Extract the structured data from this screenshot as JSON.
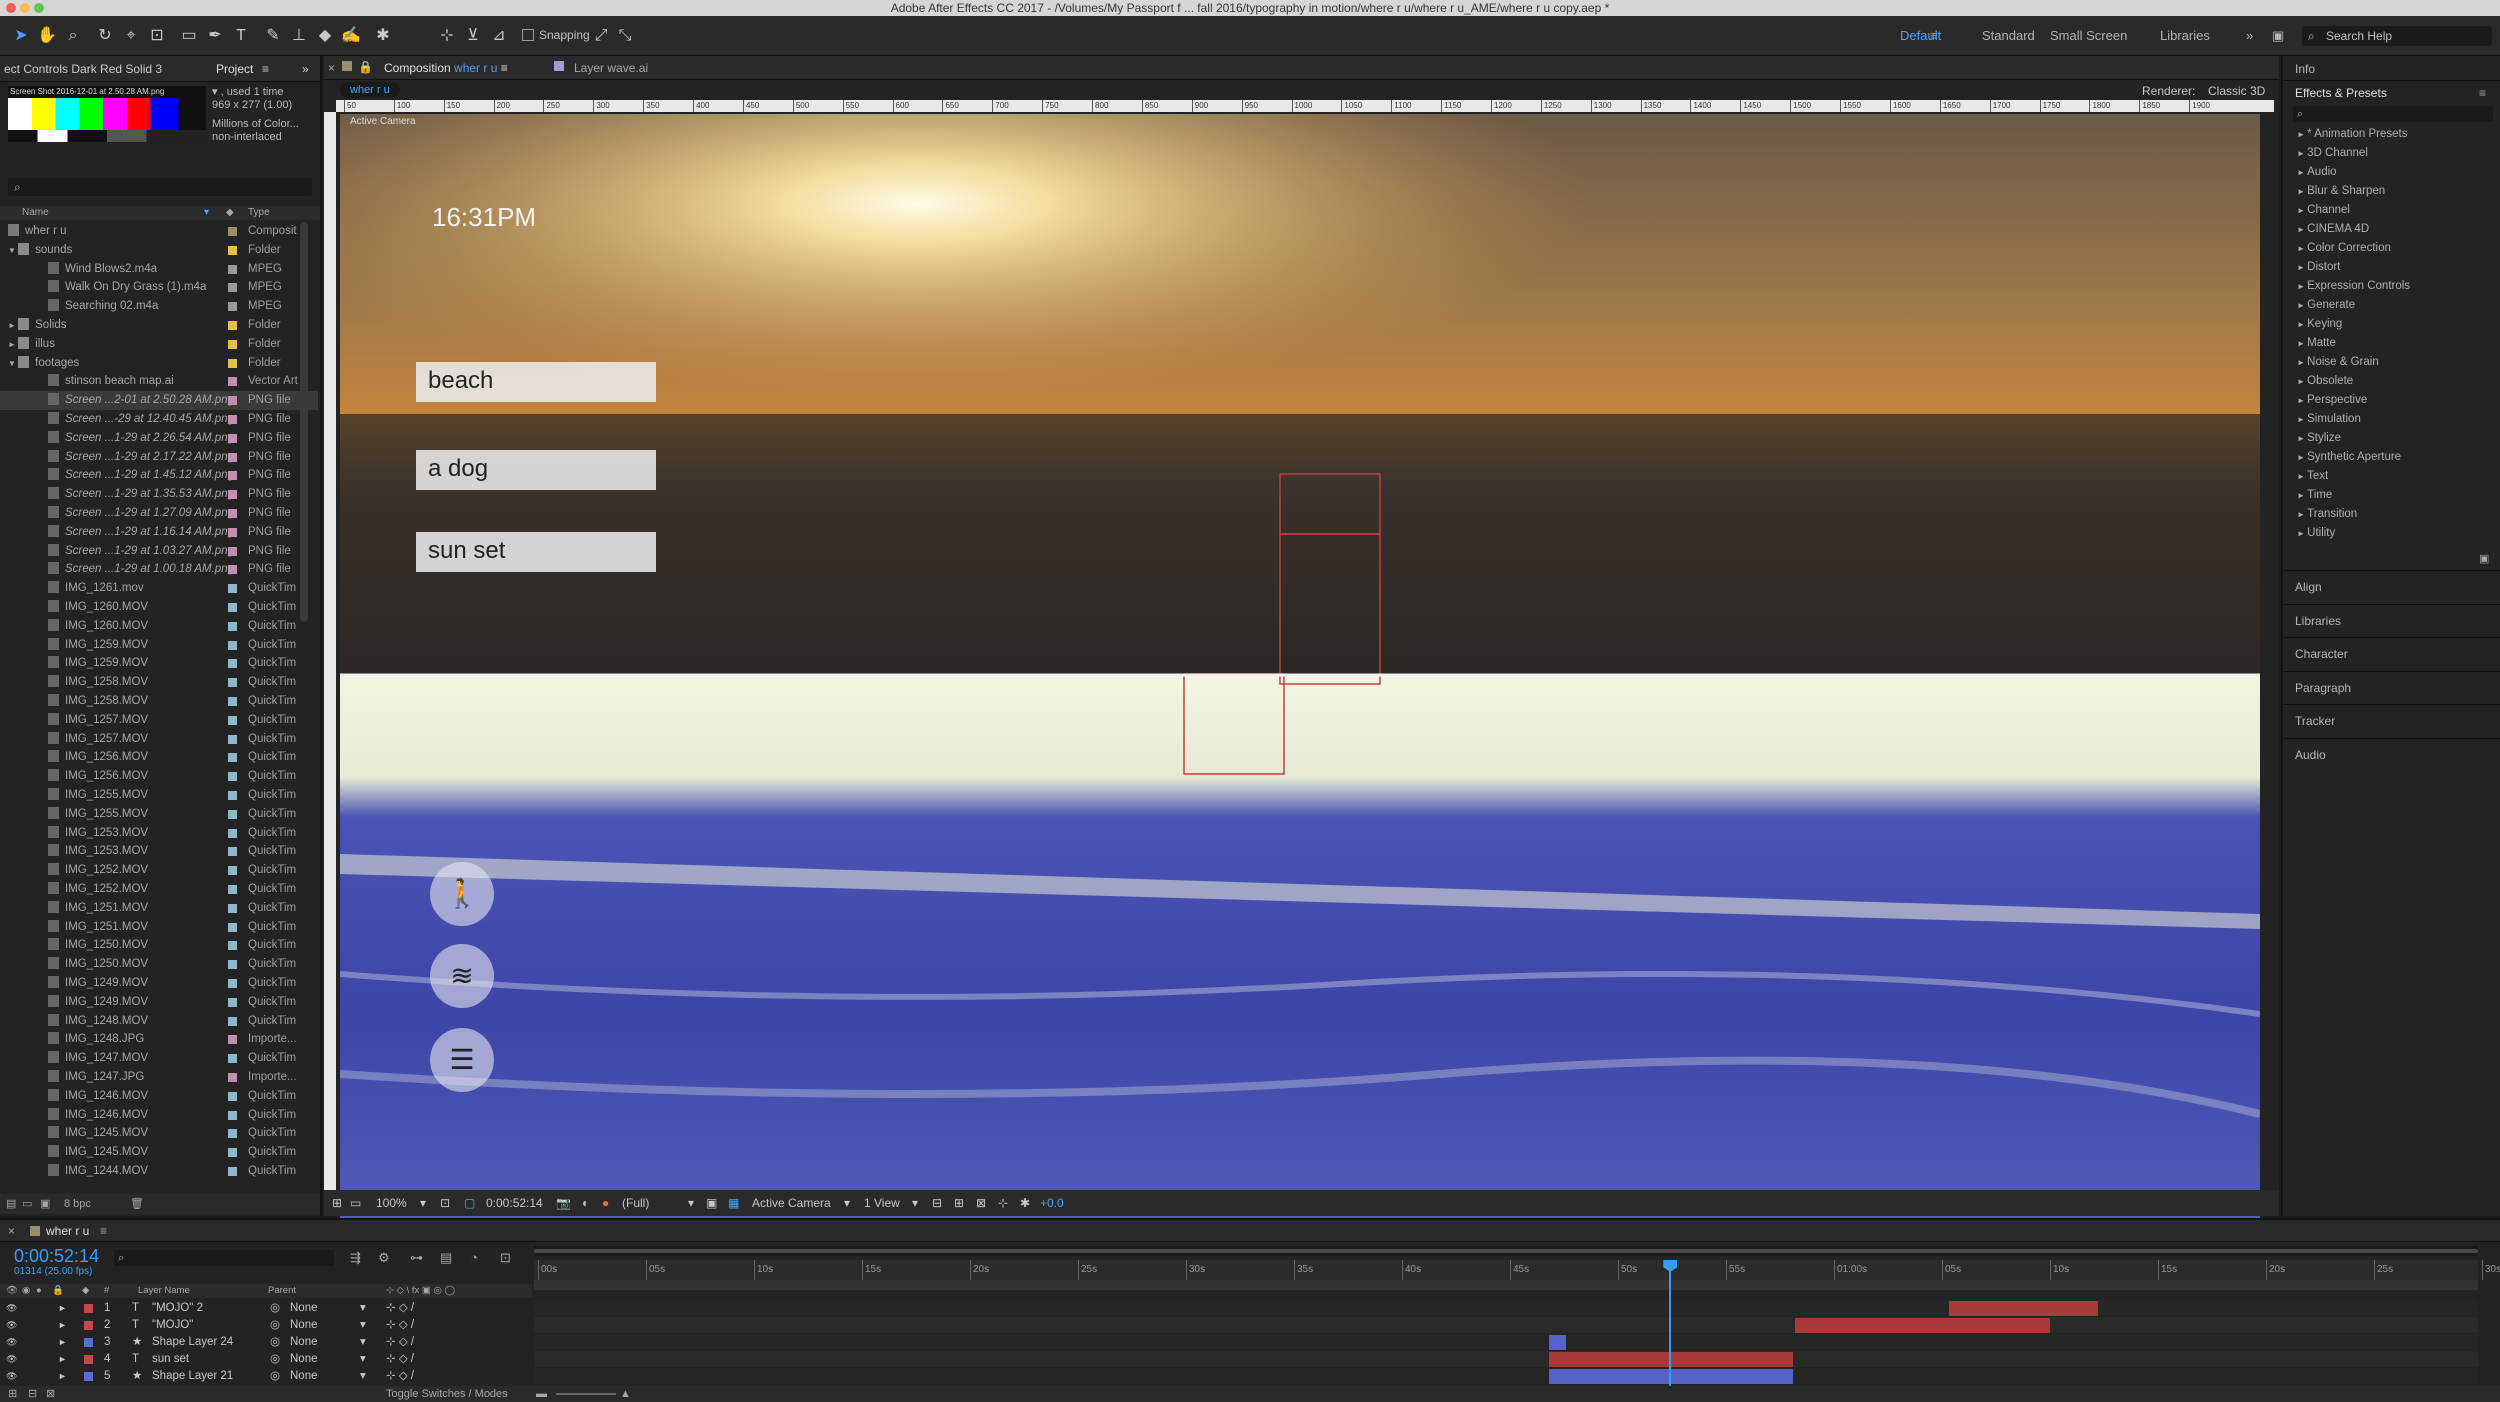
{
  "titlebar": {
    "title": "Adobe After Effects CC 2017 - /Volumes/My Passport f ... fall 2016/typography in motion/where r u/where r u_AME/where r u copy.aep *"
  },
  "toolbar": {
    "snapping": "Snapping",
    "workspaces": [
      "Default",
      "Standard",
      "Small Screen",
      "Libraries"
    ],
    "search": "Search Help"
  },
  "effect_controls": {
    "tab": "ect Controls Dark Red Solid 3",
    "project_tab": "Project"
  },
  "project": {
    "thumb_caption": "Screen Shot 2016-12-01 at 2.50.28 AM.png",
    "info": [
      "▾ , used 1 time",
      "969 x 277 (1.00)",
      "Millions of Color...",
      "non-interlaced"
    ],
    "col_name": "Name",
    "col_type": "Type",
    "items": [
      {
        "name": "wher r u",
        "type": "Composit",
        "indent": 0,
        "swatch": "#9a8f6a",
        "kind": "comp"
      },
      {
        "name": "sounds",
        "type": "Folder",
        "indent": 0,
        "swatch": "#e6c14a",
        "kind": "folder",
        "open": true
      },
      {
        "name": "Wind Blows2.m4a",
        "type": "MPEG",
        "indent": 2,
        "swatch": "#9a9a9a",
        "kind": "file"
      },
      {
        "name": "Walk On Dry Grass (1).m4a",
        "type": "MPEG",
        "indent": 2,
        "swatch": "#9a9a9a",
        "kind": "file"
      },
      {
        "name": "Searching 02.m4a",
        "type": "MPEG",
        "indent": 2,
        "swatch": "#9a9a9a",
        "kind": "file"
      },
      {
        "name": "Solids",
        "type": "Folder",
        "indent": 0,
        "swatch": "#e6c14a",
        "kind": "folder"
      },
      {
        "name": "illus",
        "type": "Folder",
        "indent": 0,
        "swatch": "#e6c14a",
        "kind": "folder"
      },
      {
        "name": "footages",
        "type": "Folder",
        "indent": 0,
        "swatch": "#e6c14a",
        "kind": "folder",
        "open": true
      },
      {
        "name": "stinson beach map.ai",
        "type": "Vector Art",
        "indent": 2,
        "swatch": "#c28fb0",
        "kind": "file"
      },
      {
        "name": "Screen ...2-01 at 2.50.28 AM.png",
        "type": "PNG file",
        "indent": 2,
        "swatch": "#c28fb0",
        "kind": "file",
        "selected": true
      },
      {
        "name": "Screen ...-29 at 12.40.45 AM.png",
        "type": "PNG file",
        "indent": 2,
        "swatch": "#c28fb0",
        "kind": "file"
      },
      {
        "name": "Screen ...1-29 at 2.26.54 AM.png",
        "type": "PNG file",
        "indent": 2,
        "swatch": "#c28fb0",
        "kind": "file"
      },
      {
        "name": "Screen ...1-29 at 2.17.22 AM.png",
        "type": "PNG file",
        "indent": 2,
        "swatch": "#c28fb0",
        "kind": "file"
      },
      {
        "name": "Screen ...1-29 at 1.45.12 AM.png",
        "type": "PNG file",
        "indent": 2,
        "swatch": "#c28fb0",
        "kind": "file"
      },
      {
        "name": "Screen ...1-29 at 1.35.53 AM.png",
        "type": "PNG file",
        "indent": 2,
        "swatch": "#c28fb0",
        "kind": "file"
      },
      {
        "name": "Screen ...1-29 at 1.27.09 AM.png",
        "type": "PNG file",
        "indent": 2,
        "swatch": "#c28fb0",
        "kind": "file"
      },
      {
        "name": "Screen ...1-29 at 1.16.14 AM.png",
        "type": "PNG file",
        "indent": 2,
        "swatch": "#c28fb0",
        "kind": "file"
      },
      {
        "name": "Screen ...1-29 at 1.03.27 AM.png",
        "type": "PNG file",
        "indent": 2,
        "swatch": "#c28fb0",
        "kind": "file"
      },
      {
        "name": "Screen ...1-29 at 1.00.18 AM.png",
        "type": "PNG file",
        "indent": 2,
        "swatch": "#c28fb0",
        "kind": "file"
      },
      {
        "name": "IMG_1261.mov",
        "type": "QuickTim",
        "indent": 2,
        "swatch": "#8fb8c8",
        "kind": "file"
      },
      {
        "name": "IMG_1260.MOV",
        "type": "QuickTim",
        "indent": 2,
        "swatch": "#8fb8c8",
        "kind": "file"
      },
      {
        "name": "IMG_1260.MOV",
        "type": "QuickTim",
        "indent": 2,
        "swatch": "#8fb8c8",
        "kind": "file"
      },
      {
        "name": "IMG_1259.MOV",
        "type": "QuickTim",
        "indent": 2,
        "swatch": "#8fb8c8",
        "kind": "file"
      },
      {
        "name": "IMG_1259.MOV",
        "type": "QuickTim",
        "indent": 2,
        "swatch": "#8fb8c8",
        "kind": "file"
      },
      {
        "name": "IMG_1258.MOV",
        "type": "QuickTim",
        "indent": 2,
        "swatch": "#8fb8c8",
        "kind": "file"
      },
      {
        "name": "IMG_1258.MOV",
        "type": "QuickTim",
        "indent": 2,
        "swatch": "#8fb8c8",
        "kind": "file"
      },
      {
        "name": "IMG_1257.MOV",
        "type": "QuickTim",
        "indent": 2,
        "swatch": "#8fb8c8",
        "kind": "file"
      },
      {
        "name": "IMG_1257.MOV",
        "type": "QuickTim",
        "indent": 2,
        "swatch": "#8fb8c8",
        "kind": "file"
      },
      {
        "name": "IMG_1256.MOV",
        "type": "QuickTim",
        "indent": 2,
        "swatch": "#8fb8c8",
        "kind": "file"
      },
      {
        "name": "IMG_1256.MOV",
        "type": "QuickTim",
        "indent": 2,
        "swatch": "#8fb8c8",
        "kind": "file"
      },
      {
        "name": "IMG_1255.MOV",
        "type": "QuickTim",
        "indent": 2,
        "swatch": "#8fb8c8",
        "kind": "file"
      },
      {
        "name": "IMG_1255.MOV",
        "type": "QuickTim",
        "indent": 2,
        "swatch": "#8fb8c8",
        "kind": "file"
      },
      {
        "name": "IMG_1253.MOV",
        "type": "QuickTim",
        "indent": 2,
        "swatch": "#8fb8c8",
        "kind": "file"
      },
      {
        "name": "IMG_1253.MOV",
        "type": "QuickTim",
        "indent": 2,
        "swatch": "#8fb8c8",
        "kind": "file"
      },
      {
        "name": "IMG_1252.MOV",
        "type": "QuickTim",
        "indent": 2,
        "swatch": "#8fb8c8",
        "kind": "file"
      },
      {
        "name": "IMG_1252.MOV",
        "type": "QuickTim",
        "indent": 2,
        "swatch": "#8fb8c8",
        "kind": "file"
      },
      {
        "name": "IMG_1251.MOV",
        "type": "QuickTim",
        "indent": 2,
        "swatch": "#8fb8c8",
        "kind": "file"
      },
      {
        "name": "IMG_1251.MOV",
        "type": "QuickTim",
        "indent": 2,
        "swatch": "#8fb8c8",
        "kind": "file"
      },
      {
        "name": "IMG_1250.MOV",
        "type": "QuickTim",
        "indent": 2,
        "swatch": "#8fb8c8",
        "kind": "file"
      },
      {
        "name": "IMG_1250.MOV",
        "type": "QuickTim",
        "indent": 2,
        "swatch": "#8fb8c8",
        "kind": "file"
      },
      {
        "name": "IMG_1249.MOV",
        "type": "QuickTim",
        "indent": 2,
        "swatch": "#8fb8c8",
        "kind": "file"
      },
      {
        "name": "IMG_1249.MOV",
        "type": "QuickTim",
        "indent": 2,
        "swatch": "#8fb8c8",
        "kind": "file"
      },
      {
        "name": "IMG_1248.MOV",
        "type": "QuickTim",
        "indent": 2,
        "swatch": "#8fb8c8",
        "kind": "file"
      },
      {
        "name": "IMG_1248.JPG",
        "type": "Importe...",
        "indent": 2,
        "swatch": "#c28fb0",
        "kind": "file"
      },
      {
        "name": "IMG_1247.MOV",
        "type": "QuickTim",
        "indent": 2,
        "swatch": "#8fb8c8",
        "kind": "file"
      },
      {
        "name": "IMG_1247.JPG",
        "type": "Importe...",
        "indent": 2,
        "swatch": "#c28fb0",
        "kind": "file"
      },
      {
        "name": "IMG_1246.MOV",
        "type": "QuickTim",
        "indent": 2,
        "swatch": "#8fb8c8",
        "kind": "file"
      },
      {
        "name": "IMG_1246.MOV",
        "type": "QuickTim",
        "indent": 2,
        "swatch": "#8fb8c8",
        "kind": "file"
      },
      {
        "name": "IMG_1245.MOV",
        "type": "QuickTim",
        "indent": 2,
        "swatch": "#8fb8c8",
        "kind": "file"
      },
      {
        "name": "IMG_1245.MOV",
        "type": "QuickTim",
        "indent": 2,
        "swatch": "#8fb8c8",
        "kind": "file"
      },
      {
        "name": "IMG_1244.MOV",
        "type": "QuickTim",
        "indent": 2,
        "swatch": "#8fb8c8",
        "kind": "file"
      }
    ],
    "bpc": "8 bpc"
  },
  "composition": {
    "tab_label": "Composition",
    "tab_comp": "wher r u",
    "layer_tab": "Layer wave.ai",
    "comp_pill": "wher r u",
    "renderer_label": "Renderer:",
    "renderer": "Classic 3D",
    "active_camera_label": "Active Camera",
    "ruler": [
      "50",
      "100",
      "150",
      "200",
      "250",
      "300",
      "350",
      "400",
      "450",
      "500",
      "550",
      "600",
      "650",
      "700",
      "750",
      "800",
      "850",
      "900",
      "950",
      "1000",
      "1050",
      "1100",
      "1150",
      "1200",
      "1250",
      "1300",
      "1350",
      "1400",
      "1450",
      "1500",
      "1550",
      "1600",
      "1650",
      "1700",
      "1750",
      "1800",
      "1850",
      "1900"
    ],
    "time_overlay": "16:31PM",
    "words": [
      "beach",
      "a dog",
      "sun set"
    ]
  },
  "viewer_footer": {
    "zoom": "100%",
    "timecode": "0:00:52:14",
    "resolution": "(Full)",
    "camera": "Active Camera",
    "views": "1 View",
    "exposure": "+0.0"
  },
  "right_panel": {
    "info": "Info",
    "effects_title": "Effects & Presets",
    "effects": [
      "* Animation Presets",
      "3D Channel",
      "Audio",
      "Blur & Sharpen",
      "Channel",
      "CINEMA 4D",
      "Color Correction",
      "Distort",
      "Expression Controls",
      "Generate",
      "Keying",
      "Matte",
      "Noise & Grain",
      "Obsolete",
      "Perspective",
      "Simulation",
      "Stylize",
      "Synthetic Aperture",
      "Text",
      "Time",
      "Transition",
      "Utility"
    ],
    "sections": [
      "Align",
      "Libraries",
      "Character",
      "Paragraph",
      "Tracker",
      "Audio"
    ]
  },
  "timeline": {
    "comp_tab": "wher r u",
    "timecode": "0:00:52:14",
    "frames": "01314 (25.00 fps)",
    "col_layer": "Layer Name",
    "col_parent": "Parent",
    "col_num": "#",
    "ticks": [
      "00s",
      "05s",
      "10s",
      "15s",
      "20s",
      "25s",
      "30s",
      "35s",
      "40s",
      "45s",
      "50s",
      "55s",
      "01:00s",
      "05s",
      "10s",
      "15s",
      "20s",
      "25s",
      "30s"
    ],
    "layers": [
      {
        "num": "1",
        "type": "T",
        "name": "\"MOJO\" 2",
        "parent": "None",
        "color": "#c24a4a"
      },
      {
        "num": "2",
        "type": "T",
        "name": "\"MOJO\"",
        "parent": "None",
        "color": "#c24a4a"
      },
      {
        "num": "3",
        "type": "★",
        "name": "Shape Layer 24",
        "parent": "None",
        "color": "#5a6fd0"
      },
      {
        "num": "4",
        "type": "T",
        "name": "sun set",
        "parent": "None",
        "color": "#c24a4a"
      },
      {
        "num": "5",
        "type": "★",
        "name": "Shape Layer 21",
        "parent": "None",
        "color": "#5a6fd0"
      }
    ],
    "playhead_seconds": 52.56,
    "duration_seconds": 90,
    "bars": [
      {
        "row": 0,
        "start": 65.5,
        "end": 72.4,
        "color": "#a83a3a"
      },
      {
        "row": 1,
        "start": 58.4,
        "end": 70.2,
        "color": "#a83a3a"
      },
      {
        "row": 2,
        "start": 47.0,
        "end": 47.8,
        "color": "#5563c8"
      },
      {
        "row": 3,
        "start": 47.0,
        "end": 58.3,
        "color": "#a83a3a"
      },
      {
        "row": 4,
        "start": 47.0,
        "end": 58.3,
        "color": "#5563c8"
      }
    ],
    "toggle": "Toggle Switches / Modes"
  },
  "colors": {
    "accent": "#2d8ceb",
    "timecode": "#3a9df5"
  }
}
